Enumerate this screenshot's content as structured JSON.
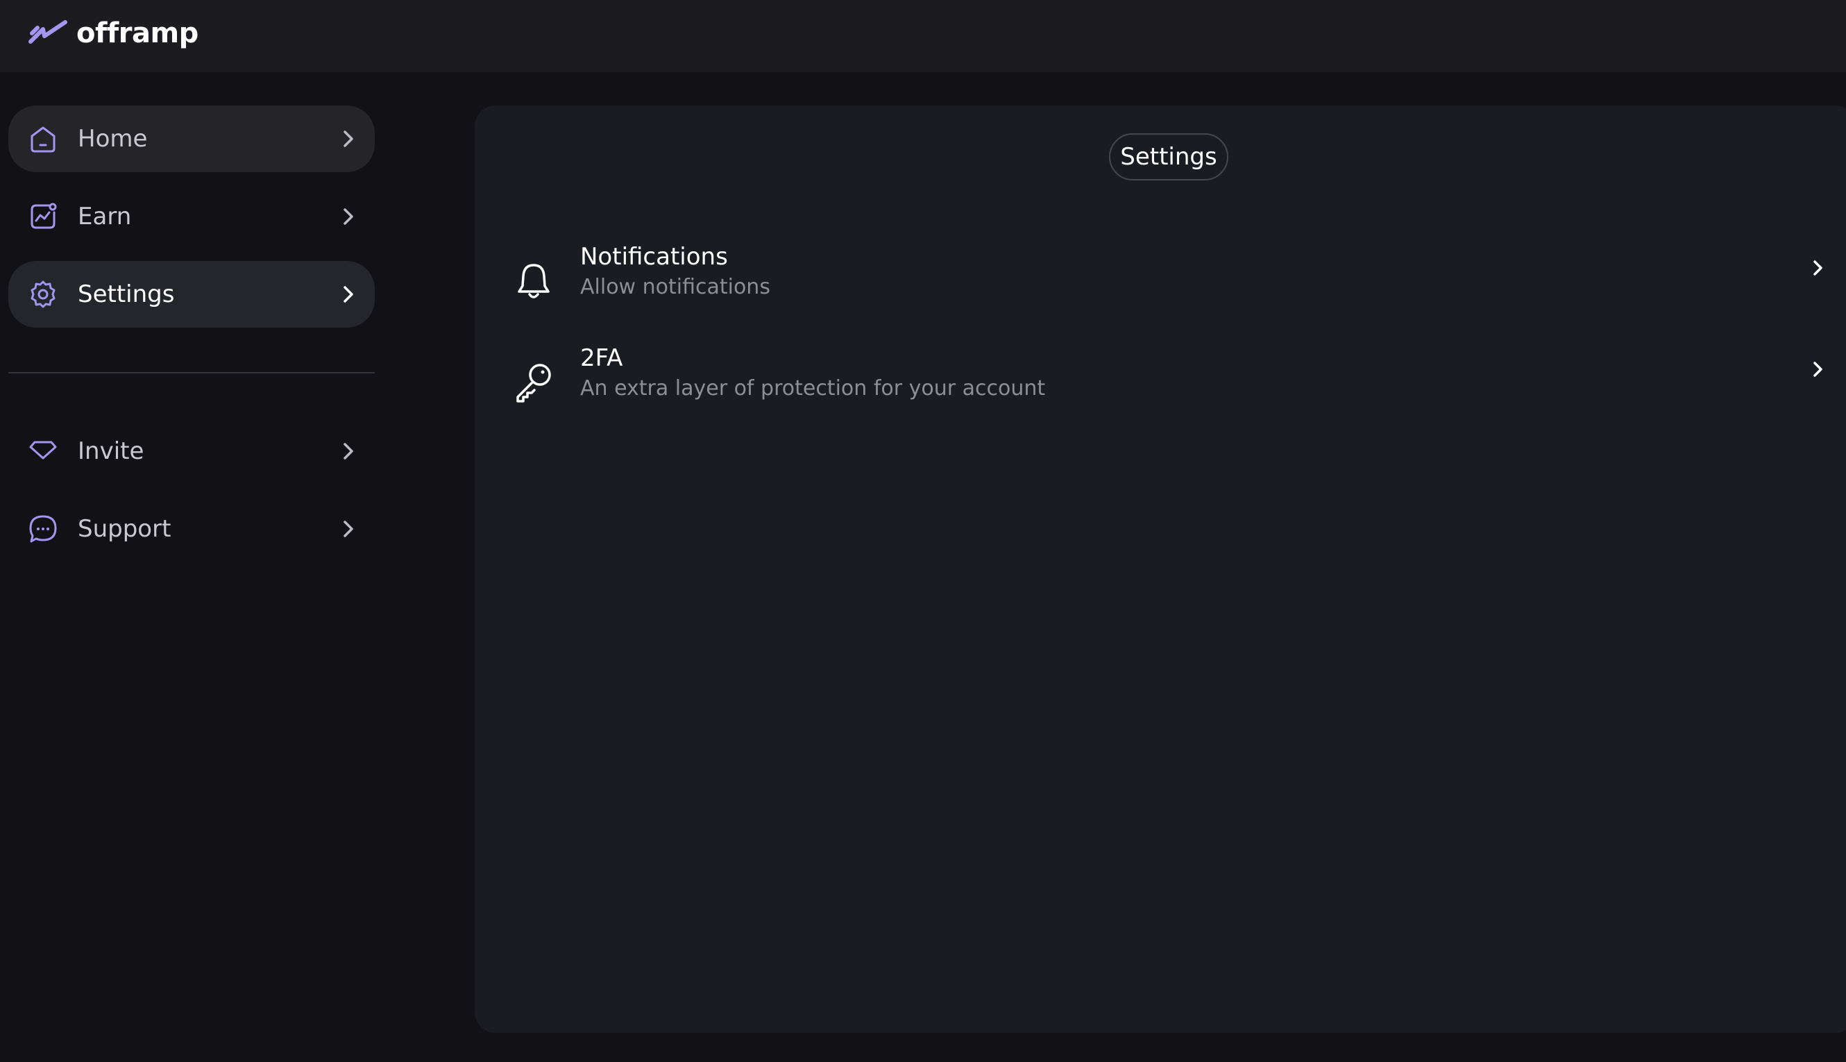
{
  "app": {
    "logo_text": "offramp",
    "accent_color": "#a395f0"
  },
  "sidebar": {
    "items": [
      {
        "label": "Home",
        "icon": "home-icon"
      },
      {
        "label": "Earn",
        "icon": "chart-icon"
      },
      {
        "label": "Settings",
        "icon": "gear-icon",
        "active": true
      },
      {
        "label": "Invite",
        "icon": "diamond-icon"
      },
      {
        "label": "Support",
        "icon": "chat-bubble-icon"
      }
    ]
  },
  "main": {
    "title": "Settings",
    "rows": [
      {
        "title": "Notifications",
        "subtitle": "Allow notifications",
        "icon": "bell-icon"
      },
      {
        "title": "2FA",
        "subtitle": "An extra layer of protection for your account",
        "icon": "key-icon"
      }
    ]
  }
}
